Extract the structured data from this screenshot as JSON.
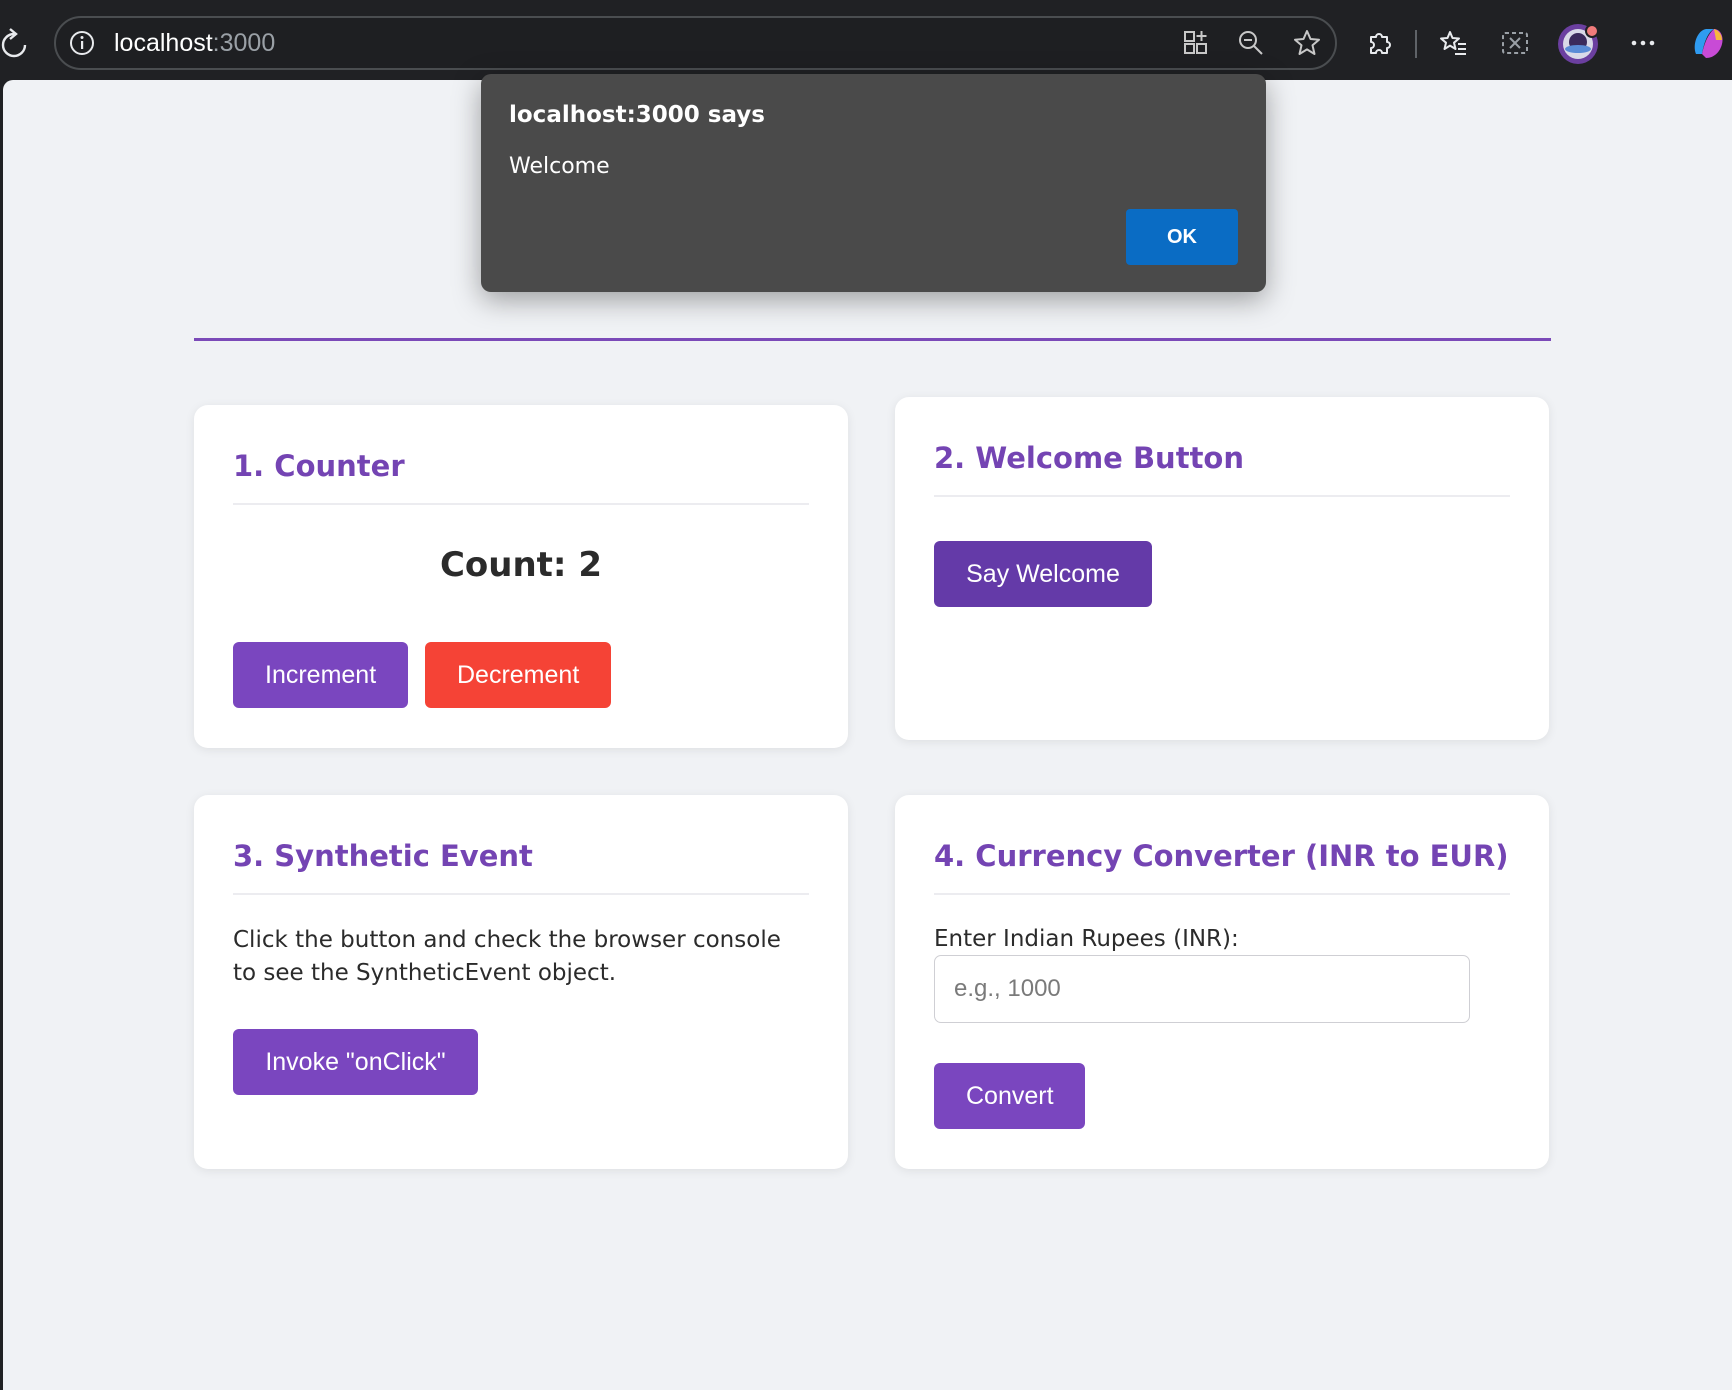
{
  "browser": {
    "url_host": "localhost",
    "url_port": ":3000",
    "icons": [
      "reload-icon",
      "site-info-icon",
      "app-grid-icon",
      "zoom-out-icon",
      "favorite-star-icon",
      "extensions-icon",
      "favorites-list-icon",
      "screenshot-icon",
      "profile-avatar-icon",
      "more-menu-icon",
      "copilot-icon"
    ]
  },
  "dialog": {
    "title": "localhost:3000 says",
    "message": "Welcome",
    "ok_label": "OK"
  },
  "cards": {
    "counter": {
      "title": "1. Counter",
      "count_label": "Count: 2",
      "increment_label": "Increment",
      "decrement_label": "Decrement"
    },
    "welcome": {
      "title": "2. Welcome Button",
      "button_label": "Say Welcome"
    },
    "synthetic": {
      "title": "3. Synthetic Event",
      "description": "Click the button and check the browser console to see the SyntheticEvent object.",
      "button_label": "Invoke \"onClick\""
    },
    "currency": {
      "title": "4. Currency Converter (INR to EUR)",
      "input_label": "Enter Indian Rupees (INR):",
      "input_placeholder": "e.g., 1000",
      "input_value": "",
      "button_label": "Convert"
    }
  },
  "colors": {
    "accent_purple": "#7a46bf",
    "dark_purple": "#643aa8",
    "danger_red": "#f54336",
    "dialog_blue": "#0a6cc4"
  }
}
